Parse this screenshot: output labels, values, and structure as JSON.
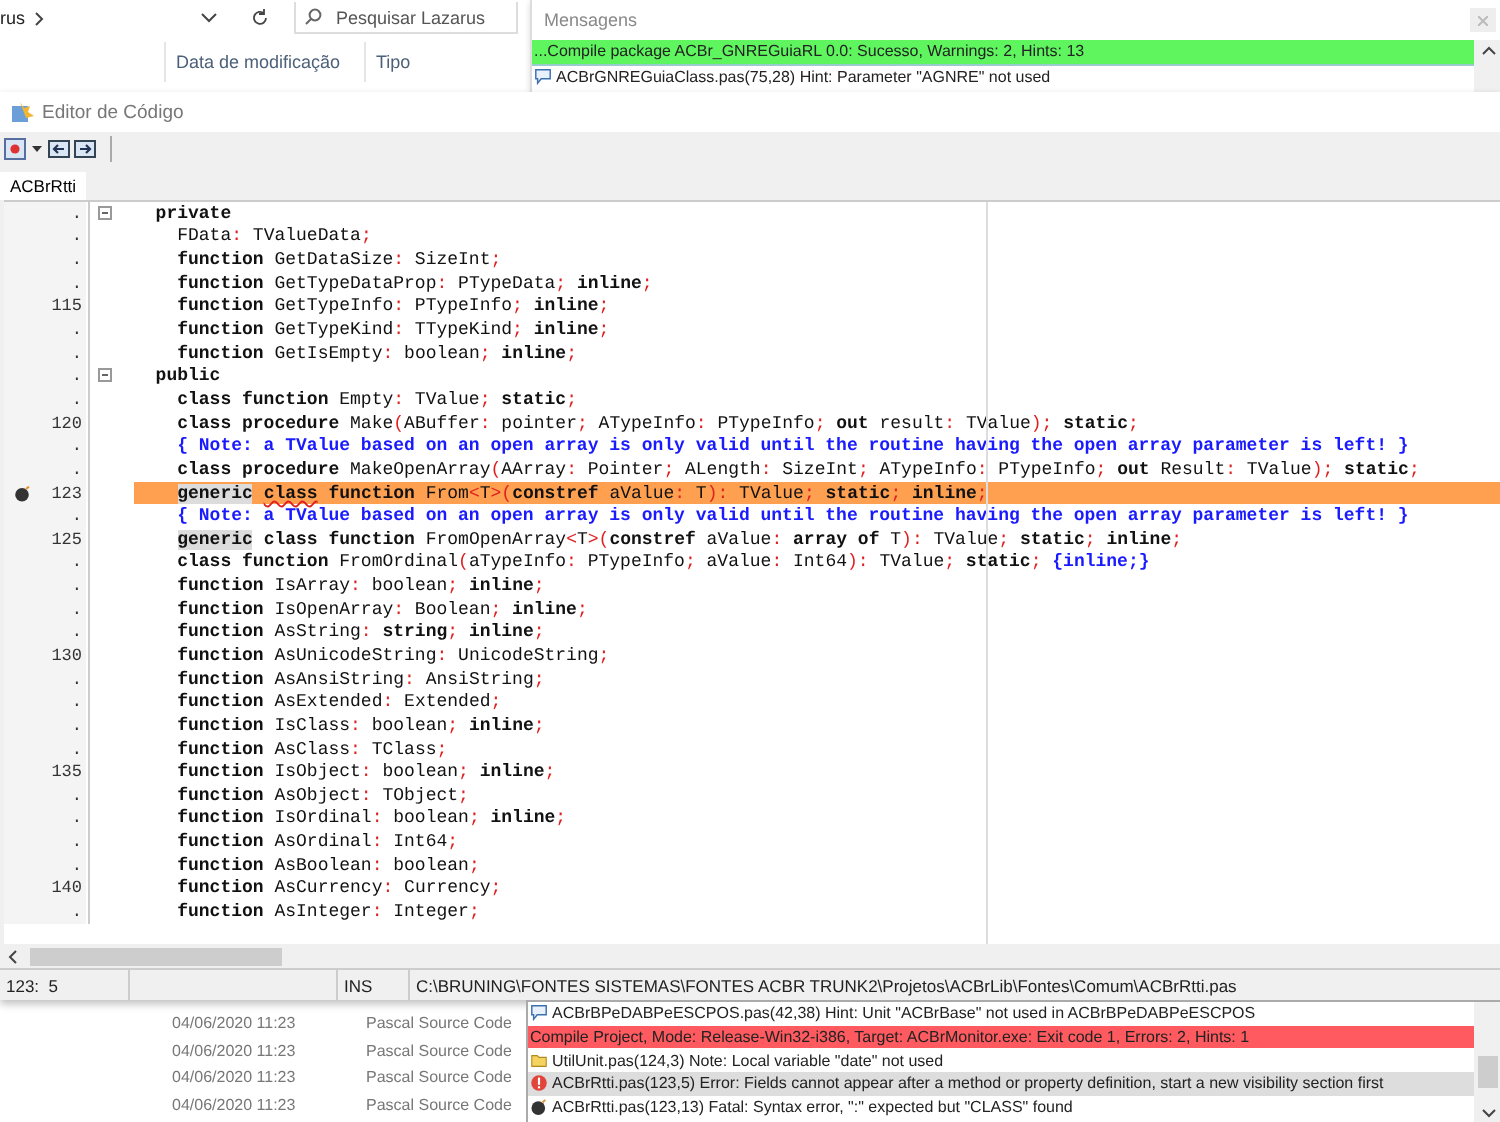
{
  "explorer": {
    "breadcrumb": "rus",
    "search": {
      "placeholder": "Pesquisar Lazarus"
    },
    "columns": [
      "Data de modificação",
      "Tipo"
    ],
    "rows": [
      {
        "date": "04/06/2020 11:23",
        "type": "Pascal Source Code"
      },
      {
        "date": "04/06/2020 11:23",
        "type": "Pascal Source Code"
      },
      {
        "date": "04/06/2020 11:23",
        "type": "Pascal Source Code"
      },
      {
        "date": "04/06/2020 11:23",
        "type": "Pascal Source Code"
      }
    ]
  },
  "messages_top": {
    "title": "Mensagens",
    "items": [
      {
        "kind": "success",
        "text": "...Compile package ACBr_GNREGuiaRL 0.0: Sucesso, Warnings: 2, Hints: 13"
      },
      {
        "kind": "hint",
        "text": "ACBrGNREGuiaClass.pas(75,28) Hint: Parameter \"AGNRE\" not used"
      }
    ]
  },
  "editor": {
    "title": "Editor de Código",
    "tabs": [
      {
        "label": "ACBrRtti",
        "selected": true
      }
    ],
    "lines": [
      {
        "number": ".",
        "fold": true,
        "highlighted": false,
        "segments": [
          {
            "kind": "kw",
            "text": "  private"
          }
        ]
      },
      {
        "number": ".",
        "fold": false,
        "highlighted": false,
        "segments": [
          {
            "kind": "id",
            "text": "    FData"
          },
          {
            "kind": "sym",
            "text": ":"
          },
          {
            "kind": "id",
            "text": " TValueData"
          },
          {
            "kind": "sym",
            "text": ";"
          }
        ]
      },
      {
        "number": ".",
        "fold": false,
        "highlighted": false,
        "segments": [
          {
            "kind": "kw",
            "text": "    function"
          },
          {
            "kind": "id",
            "text": " GetDataSize"
          },
          {
            "kind": "sym",
            "text": ":"
          },
          {
            "kind": "id",
            "text": " SizeInt"
          },
          {
            "kind": "sym",
            "text": ";"
          }
        ]
      },
      {
        "number": ".",
        "fold": false,
        "highlighted": false,
        "segments": [
          {
            "kind": "kw",
            "text": "    function"
          },
          {
            "kind": "id",
            "text": " GetTypeDataProp"
          },
          {
            "kind": "sym",
            "text": ":"
          },
          {
            "kind": "id",
            "text": " PTypeData"
          },
          {
            "kind": "sym",
            "text": ";"
          },
          {
            "kind": "kw",
            "text": " inline"
          },
          {
            "kind": "sym",
            "text": ";"
          }
        ]
      },
      {
        "number": "115",
        "fold": false,
        "highlighted": false,
        "segments": [
          {
            "kind": "kw",
            "text": "    function"
          },
          {
            "kind": "id",
            "text": " GetTypeInfo"
          },
          {
            "kind": "sym",
            "text": ":"
          },
          {
            "kind": "id",
            "text": " PTypeInfo"
          },
          {
            "kind": "sym",
            "text": ";"
          },
          {
            "kind": "kw",
            "text": " inline"
          },
          {
            "kind": "sym",
            "text": ";"
          }
        ]
      },
      {
        "number": ".",
        "fold": false,
        "highlighted": false,
        "segments": [
          {
            "kind": "kw",
            "text": "    function"
          },
          {
            "kind": "id",
            "text": " GetTypeKind"
          },
          {
            "kind": "sym",
            "text": ":"
          },
          {
            "kind": "id",
            "text": " TTypeKind"
          },
          {
            "kind": "sym",
            "text": ";"
          },
          {
            "kind": "kw",
            "text": " inline"
          },
          {
            "kind": "sym",
            "text": ";"
          }
        ]
      },
      {
        "number": ".",
        "fold": false,
        "highlighted": false,
        "segments": [
          {
            "kind": "kw",
            "text": "    function"
          },
          {
            "kind": "id",
            "text": " GetIsEmpty"
          },
          {
            "kind": "sym",
            "text": ":"
          },
          {
            "kind": "id",
            "text": " boolean"
          },
          {
            "kind": "sym",
            "text": ";"
          },
          {
            "kind": "kw",
            "text": " inline"
          },
          {
            "kind": "sym",
            "text": ";"
          }
        ]
      },
      {
        "number": ".",
        "fold": true,
        "highlighted": false,
        "segments": [
          {
            "kind": "kw",
            "text": "  public"
          }
        ]
      },
      {
        "number": ".",
        "fold": false,
        "highlighted": false,
        "segments": [
          {
            "kind": "kw",
            "text": "    class function"
          },
          {
            "kind": "id",
            "text": " Empty"
          },
          {
            "kind": "sym",
            "text": ":"
          },
          {
            "kind": "id",
            "text": " TValue"
          },
          {
            "kind": "sym",
            "text": ";"
          },
          {
            "kind": "kw",
            "text": " static"
          },
          {
            "kind": "sym",
            "text": ";"
          }
        ]
      },
      {
        "number": "120",
        "fold": false,
        "highlighted": false,
        "segments": [
          {
            "kind": "kw",
            "text": "    class procedure"
          },
          {
            "kind": "id",
            "text": " Make"
          },
          {
            "kind": "sym",
            "text": "("
          },
          {
            "kind": "id",
            "text": "ABuffer"
          },
          {
            "kind": "sym",
            "text": ":"
          },
          {
            "kind": "id",
            "text": " pointer"
          },
          {
            "kind": "sym",
            "text": ";"
          },
          {
            "kind": "id",
            "text": " ATypeInfo"
          },
          {
            "kind": "sym",
            "text": ":"
          },
          {
            "kind": "id",
            "text": " PTypeInfo"
          },
          {
            "kind": "sym",
            "text": ";"
          },
          {
            "kind": "kw",
            "text": " out"
          },
          {
            "kind": "id",
            "text": " result"
          },
          {
            "kind": "sym",
            "text": ":"
          },
          {
            "kind": "id",
            "text": " TValue"
          },
          {
            "kind": "sym",
            "text": ");"
          },
          {
            "kind": "kw",
            "text": " static"
          },
          {
            "kind": "sym",
            "text": ";"
          }
        ]
      },
      {
        "number": ".",
        "fold": false,
        "highlighted": false,
        "segments": [
          {
            "kind": "cm",
            "text": "    { Note: a TValue based on an open array is only valid until the routine having the open array parameter is left! }"
          }
        ]
      },
      {
        "number": ".",
        "fold": false,
        "highlighted": false,
        "segments": [
          {
            "kind": "kw",
            "text": "    class procedure"
          },
          {
            "kind": "id",
            "text": " MakeOpenArray"
          },
          {
            "kind": "sym",
            "text": "("
          },
          {
            "kind": "id",
            "text": "AArray"
          },
          {
            "kind": "sym",
            "text": ":"
          },
          {
            "kind": "id",
            "text": " Pointer"
          },
          {
            "kind": "sym",
            "text": ";"
          },
          {
            "kind": "id",
            "text": " ALength"
          },
          {
            "kind": "sym",
            "text": ":"
          },
          {
            "kind": "id",
            "text": " SizeInt"
          },
          {
            "kind": "sym",
            "text": ";"
          },
          {
            "kind": "id",
            "text": " ATypeInfo"
          },
          {
            "kind": "sym",
            "text": ":"
          },
          {
            "kind": "id",
            "text": " PTypeInfo"
          },
          {
            "kind": "sym",
            "text": ";"
          },
          {
            "kind": "kw",
            "text": " out"
          },
          {
            "kind": "id",
            "text": " Result"
          },
          {
            "kind": "sym",
            "text": ":"
          },
          {
            "kind": "id",
            "text": " TValue"
          },
          {
            "kind": "sym",
            "text": ");"
          },
          {
            "kind": "kw",
            "text": " static"
          },
          {
            "kind": "sym",
            "text": ";"
          }
        ]
      },
      {
        "number": "123",
        "fold": false,
        "highlighted": true,
        "marker": true,
        "segments": [
          {
            "kind": "box",
            "text": "    generic"
          },
          {
            "kind": "err",
            "text": " class"
          },
          {
            "kind": "kw",
            "text": " function"
          },
          {
            "kind": "id",
            "text": " From"
          },
          {
            "kind": "sym",
            "text": "<"
          },
          {
            "kind": "id",
            "text": "T"
          },
          {
            "kind": "sym",
            "text": ">("
          },
          {
            "kind": "kw",
            "text": "constref"
          },
          {
            "kind": "id",
            "text": " aValue"
          },
          {
            "kind": "sym",
            "text": ":"
          },
          {
            "kind": "id",
            "text": " T"
          },
          {
            "kind": "sym",
            "text": "):"
          },
          {
            "kind": "id",
            "text": " TValue"
          },
          {
            "kind": "sym",
            "text": ";"
          },
          {
            "kind": "kw",
            "text": " static"
          },
          {
            "kind": "sym",
            "text": ";"
          },
          {
            "kind": "kw",
            "text": " inline"
          },
          {
            "kind": "sym",
            "text": ";"
          }
        ]
      },
      {
        "number": ".",
        "fold": false,
        "highlighted": false,
        "segments": [
          {
            "kind": "cm",
            "text": "    { Note: a TValue based on an open array is only valid until the routine having the open array parameter is left! }"
          }
        ]
      },
      {
        "number": "125",
        "fold": false,
        "highlighted": false,
        "segments": [
          {
            "kind": "box",
            "text": "    generic"
          },
          {
            "kind": "kw",
            "text": " class function"
          },
          {
            "kind": "id",
            "text": " FromOpenArray"
          },
          {
            "kind": "sym",
            "text": "<"
          },
          {
            "kind": "id",
            "text": "T"
          },
          {
            "kind": "sym",
            "text": ">("
          },
          {
            "kind": "kw",
            "text": "constref"
          },
          {
            "kind": "id",
            "text": " aValue"
          },
          {
            "kind": "sym",
            "text": ":"
          },
          {
            "kind": "kw",
            "text": " array of"
          },
          {
            "kind": "id",
            "text": " T"
          },
          {
            "kind": "sym",
            "text": "):"
          },
          {
            "kind": "id",
            "text": " TValue"
          },
          {
            "kind": "sym",
            "text": ";"
          },
          {
            "kind": "kw",
            "text": " static"
          },
          {
            "kind": "sym",
            "text": ";"
          },
          {
            "kind": "kw",
            "text": " inline"
          },
          {
            "kind": "sym",
            "text": ";"
          }
        ]
      },
      {
        "number": ".",
        "fold": false,
        "highlighted": false,
        "segments": [
          {
            "kind": "kw",
            "text": "    class function"
          },
          {
            "kind": "id",
            "text": " FromOrdinal"
          },
          {
            "kind": "sym",
            "text": "("
          },
          {
            "kind": "id",
            "text": "aTypeInfo"
          },
          {
            "kind": "sym",
            "text": ":"
          },
          {
            "kind": "id",
            "text": " PTypeInfo"
          },
          {
            "kind": "sym",
            "text": ";"
          },
          {
            "kind": "id",
            "text": " aValue"
          },
          {
            "kind": "sym",
            "text": ":"
          },
          {
            "kind": "id",
            "text": " Int64"
          },
          {
            "kind": "sym",
            "text": "):"
          },
          {
            "kind": "id",
            "text": " TValue"
          },
          {
            "kind": "sym",
            "text": ";"
          },
          {
            "kind": "kw",
            "text": " static"
          },
          {
            "kind": "sym",
            "text": ";"
          },
          {
            "kind": "cm",
            "text": " {inline;}"
          }
        ]
      },
      {
        "number": ".",
        "fold": false,
        "highlighted": false,
        "segments": [
          {
            "kind": "kw",
            "text": "    function"
          },
          {
            "kind": "id",
            "text": " IsArray"
          },
          {
            "kind": "sym",
            "text": ":"
          },
          {
            "kind": "id",
            "text": " boolean"
          },
          {
            "kind": "sym",
            "text": ";"
          },
          {
            "kind": "kw",
            "text": " inline"
          },
          {
            "kind": "sym",
            "text": ";"
          }
        ]
      },
      {
        "number": ".",
        "fold": false,
        "highlighted": false,
        "segments": [
          {
            "kind": "kw",
            "text": "    function"
          },
          {
            "kind": "id",
            "text": " IsOpenArray"
          },
          {
            "kind": "sym",
            "text": ":"
          },
          {
            "kind": "id",
            "text": " Boolean"
          },
          {
            "kind": "sym",
            "text": ";"
          },
          {
            "kind": "kw",
            "text": " inline"
          },
          {
            "kind": "sym",
            "text": ";"
          }
        ]
      },
      {
        "number": ".",
        "fold": false,
        "highlighted": false,
        "segments": [
          {
            "kind": "kw",
            "text": "    function"
          },
          {
            "kind": "id",
            "text": " AsString"
          },
          {
            "kind": "sym",
            "text": ":"
          },
          {
            "kind": "kw",
            "text": " string"
          },
          {
            "kind": "sym",
            "text": ";"
          },
          {
            "kind": "kw",
            "text": " inline"
          },
          {
            "kind": "sym",
            "text": ";"
          }
        ]
      },
      {
        "number": "130",
        "fold": false,
        "highlighted": false,
        "segments": [
          {
            "kind": "kw",
            "text": "    function"
          },
          {
            "kind": "id",
            "text": " AsUnicodeString"
          },
          {
            "kind": "sym",
            "text": ":"
          },
          {
            "kind": "id",
            "text": " UnicodeString"
          },
          {
            "kind": "sym",
            "text": ";"
          }
        ]
      },
      {
        "number": ".",
        "fold": false,
        "highlighted": false,
        "segments": [
          {
            "kind": "kw",
            "text": "    function"
          },
          {
            "kind": "id",
            "text": " AsAnsiString"
          },
          {
            "kind": "sym",
            "text": ":"
          },
          {
            "kind": "id",
            "text": " AnsiString"
          },
          {
            "kind": "sym",
            "text": ";"
          }
        ]
      },
      {
        "number": ".",
        "fold": false,
        "highlighted": false,
        "segments": [
          {
            "kind": "kw",
            "text": "    function"
          },
          {
            "kind": "id",
            "text": " AsExtended"
          },
          {
            "kind": "sym",
            "text": ":"
          },
          {
            "kind": "id",
            "text": " Extended"
          },
          {
            "kind": "sym",
            "text": ";"
          }
        ]
      },
      {
        "number": ".",
        "fold": false,
        "highlighted": false,
        "segments": [
          {
            "kind": "kw",
            "text": "    function"
          },
          {
            "kind": "id",
            "text": " IsClass"
          },
          {
            "kind": "sym",
            "text": ":"
          },
          {
            "kind": "id",
            "text": " boolean"
          },
          {
            "kind": "sym",
            "text": ";"
          },
          {
            "kind": "kw",
            "text": " inline"
          },
          {
            "kind": "sym",
            "text": ";"
          }
        ]
      },
      {
        "number": ".",
        "fold": false,
        "highlighted": false,
        "segments": [
          {
            "kind": "kw",
            "text": "    function"
          },
          {
            "kind": "id",
            "text": " AsClass"
          },
          {
            "kind": "sym",
            "text": ":"
          },
          {
            "kind": "id",
            "text": " TClass"
          },
          {
            "kind": "sym",
            "text": ";"
          }
        ]
      },
      {
        "number": "135",
        "fold": false,
        "highlighted": false,
        "segments": [
          {
            "kind": "kw",
            "text": "    function"
          },
          {
            "kind": "id",
            "text": " IsObject"
          },
          {
            "kind": "sym",
            "text": ":"
          },
          {
            "kind": "id",
            "text": " boolean"
          },
          {
            "kind": "sym",
            "text": ";"
          },
          {
            "kind": "kw",
            "text": " inline"
          },
          {
            "kind": "sym",
            "text": ";"
          }
        ]
      },
      {
        "number": ".",
        "fold": false,
        "highlighted": false,
        "segments": [
          {
            "kind": "kw",
            "text": "    function"
          },
          {
            "kind": "id",
            "text": " AsObject"
          },
          {
            "kind": "sym",
            "text": ":"
          },
          {
            "kind": "id",
            "text": " TObject"
          },
          {
            "kind": "sym",
            "text": ";"
          }
        ]
      },
      {
        "number": ".",
        "fold": false,
        "highlighted": false,
        "segments": [
          {
            "kind": "kw",
            "text": "    function"
          },
          {
            "kind": "id",
            "text": " IsOrdinal"
          },
          {
            "kind": "sym",
            "text": ":"
          },
          {
            "kind": "id",
            "text": " boolean"
          },
          {
            "kind": "sym",
            "text": ";"
          },
          {
            "kind": "kw",
            "text": " inline"
          },
          {
            "kind": "sym",
            "text": ";"
          }
        ]
      },
      {
        "number": ".",
        "fold": false,
        "highlighted": false,
        "segments": [
          {
            "kind": "kw",
            "text": "    function"
          },
          {
            "kind": "id",
            "text": " AsOrdinal"
          },
          {
            "kind": "sym",
            "text": ":"
          },
          {
            "kind": "id",
            "text": " Int64"
          },
          {
            "kind": "sym",
            "text": ";"
          }
        ]
      },
      {
        "number": ".",
        "fold": false,
        "highlighted": false,
        "segments": [
          {
            "kind": "kw",
            "text": "    function"
          },
          {
            "kind": "id",
            "text": " AsBoolean"
          },
          {
            "kind": "sym",
            "text": ":"
          },
          {
            "kind": "id",
            "text": " boolean"
          },
          {
            "kind": "sym",
            "text": ";"
          }
        ]
      },
      {
        "number": "140",
        "fold": false,
        "highlighted": false,
        "segments": [
          {
            "kind": "kw",
            "text": "    function"
          },
          {
            "kind": "id",
            "text": " AsCurrency"
          },
          {
            "kind": "sym",
            "text": ":"
          },
          {
            "kind": "id",
            "text": " Currency"
          },
          {
            "kind": "sym",
            "text": ";"
          }
        ]
      },
      {
        "number": ".",
        "fold": false,
        "highlighted": false,
        "segments": [
          {
            "kind": "kw",
            "text": "    function"
          },
          {
            "kind": "id",
            "text": " AsInteger"
          },
          {
            "kind": "sym",
            "text": ":"
          },
          {
            "kind": "id",
            "text": " Integer"
          },
          {
            "kind": "sym",
            "text": ";"
          }
        ]
      }
    ],
    "status_bar": {
      "position": "123:  5",
      "mode": "INS",
      "path": "C:\\BRUNING\\FONTES SISTEMAS\\FONTES ACBR TRUNK2\\Projetos\\ACBrLib\\Fontes\\Comum\\ACBrRtti.pas"
    }
  },
  "messages_bottom": {
    "items": [
      {
        "kind": "hint",
        "selected": false,
        "text": "ACBrBPeDABPeESCPOS.pas(42,38) Hint: Unit \"ACBrBase\" not used in ACBrBPeDABPeESCPOS"
      },
      {
        "kind": "failure",
        "selected": false,
        "text": "Compile Project, Mode: Release-Win32-i386, Target: ACBrMonitor.exe: Exit code 1, Errors: 2, Hints: 1"
      },
      {
        "kind": "note",
        "selected": false,
        "text": "UtilUnit.pas(124,3) Note: Local variable \"date\" not used"
      },
      {
        "kind": "error",
        "selected": true,
        "text": "ACBrRtti.pas(123,5) Error: Fields cannot appear after a method or property definition, start a new visibility section first"
      },
      {
        "kind": "fatal",
        "selected": false,
        "text": "ACBrRtti.pas(123,13) Fatal: Syntax error, \":\" expected but \"CLASS\" found"
      }
    ]
  }
}
